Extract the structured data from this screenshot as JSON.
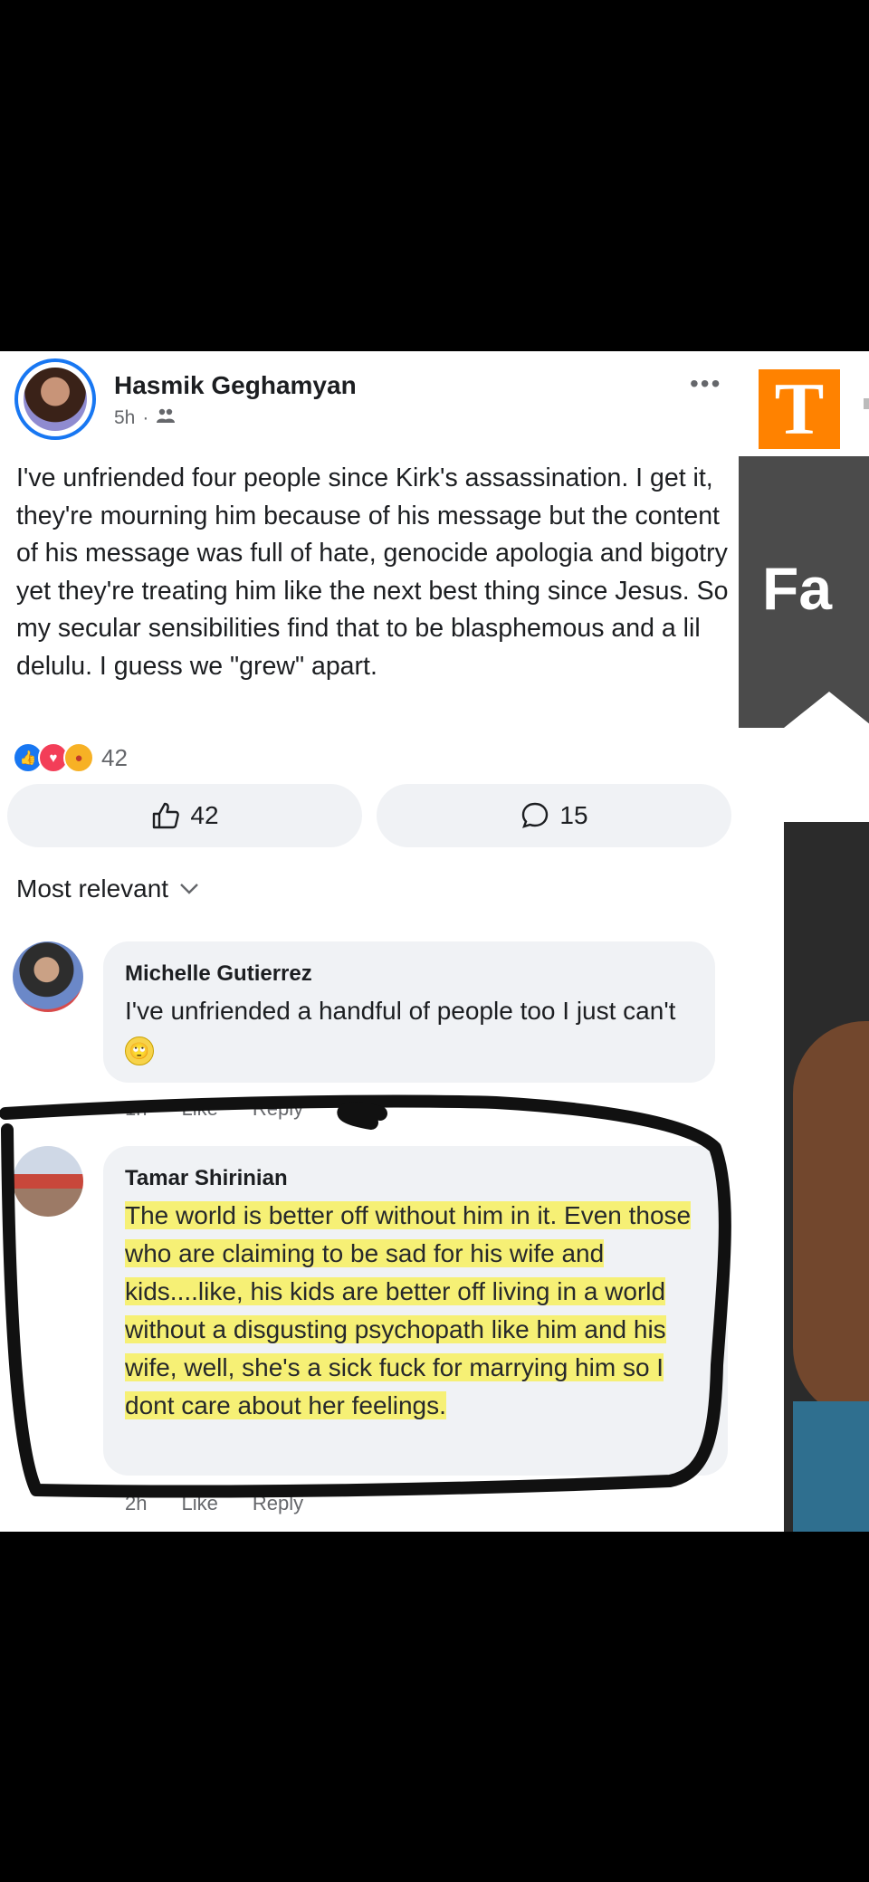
{
  "post": {
    "author": "Hasmik Geghamyan",
    "time": "5h",
    "separator": "·",
    "audience_icon": "friends-icon",
    "more_label": "•••",
    "text": "I've unfriended four people since Kirk's assassination. I get it, they're mourning him because of his message but the content of his message was full of hate, genocide apologia and bigotry yet they're treating him like the next best thing since Jesus. So my secular sensibilities find that to be blasphemous and a lil delulu. I guess we \"grew\" apart.",
    "reaction_count": "42",
    "like_count": "42",
    "comment_count": "15"
  },
  "sort": {
    "label": "Most relevant"
  },
  "comments": [
    {
      "name": "Michelle Gutierrez",
      "text": "I've unfriended a handful of people too I just can't",
      "emoji": "🙄",
      "time": "1h",
      "like": "Like",
      "reply": "Reply"
    },
    {
      "name": "Tamar Shirinian",
      "text": "The world is better off without him in it. Even those who are claiming to be sad for his wife and kids....like, his kids are better off living in a world without a disgusting psychopath like him and his wife, well, she's a sick fuck for marrying him so I dont care about her feelings.",
      "time": "2h",
      "like": "Like",
      "reply": "Reply"
    }
  ],
  "side": {
    "logo_letter": "T",
    "banner_text": "Fa"
  },
  "colors": {
    "accent": "#1877f2",
    "highlight": "#f7f06f",
    "logo": "#ff8200",
    "annotation": "#111111"
  }
}
